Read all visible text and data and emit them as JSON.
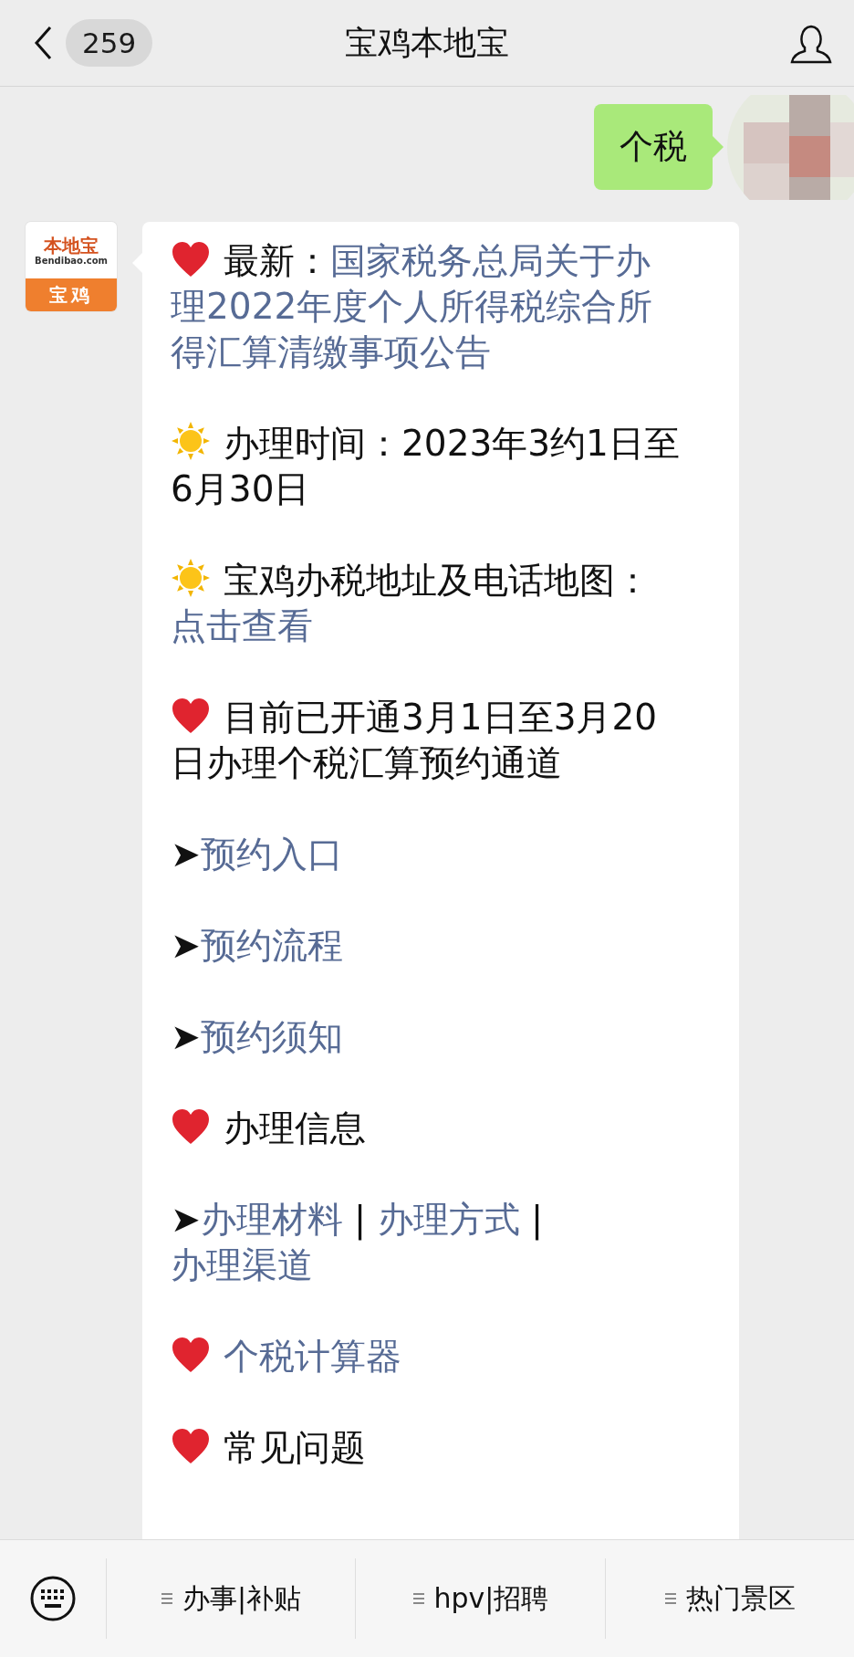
{
  "header": {
    "unread_count": "259",
    "title": "宝鸡本地宝"
  },
  "user_message": {
    "text": "个税"
  },
  "sender_logo": {
    "brand": "本地宝",
    "domain": "Bendibao.com",
    "city": "宝鸡"
  },
  "article": {
    "blocks": [
      {
        "kind": "heart",
        "segments": [
          {
            "text": "最新：",
            "link": false
          },
          {
            "text": "国家税务总局关于办",
            "link": true
          },
          {
            "text": "理2022年度个人所得税综合所",
            "link": true
          },
          {
            "text": "得汇算清缴事项公告",
            "link": true
          }
        ]
      },
      {
        "kind": "sun",
        "segments": [
          {
            "text": "办理时间：2023年3约1日至6月30日",
            "link": false
          }
        ]
      },
      {
        "kind": "sun",
        "segments": [
          {
            "text": "宝鸡办税地址及电话地图：",
            "link": false
          },
          {
            "text": "点击查看",
            "link": true
          }
        ]
      },
      {
        "kind": "heart",
        "segments": [
          {
            "text": "目前已开通3月1日至3月20日办理个税汇算预约通道",
            "link": false
          }
        ]
      },
      {
        "kind": "arrow",
        "marker": "➤",
        "segments": [
          {
            "text": "预约入口",
            "link": true
          }
        ]
      },
      {
        "kind": "arrow",
        "marker": "➤",
        "segments": [
          {
            "text": "预约流程",
            "link": true
          }
        ]
      },
      {
        "kind": "arrow",
        "marker": "➤",
        "segments": [
          {
            "text": "预约须知",
            "link": true
          }
        ]
      },
      {
        "kind": "heart",
        "segments": [
          {
            "text": "办理信息",
            "link": false
          }
        ]
      },
      {
        "kind": "arrow",
        "marker": "➤",
        "segments": [
          {
            "text": "办理材料",
            "link": true
          },
          {
            "text": " | ",
            "link": false
          },
          {
            "text": "办理方式",
            "link": true
          },
          {
            "text": " | ",
            "link": false
          },
          {
            "text": "办理渠道",
            "link": true
          }
        ]
      },
      {
        "kind": "heart",
        "segments": [
          {
            "text": "个税计算器",
            "link": true
          }
        ]
      },
      {
        "kind": "heart",
        "segments": [
          {
            "text": "常见问题",
            "link": false
          }
        ]
      }
    ]
  },
  "menu_bar": {
    "items": [
      {
        "label": "办事|补贴"
      },
      {
        "label": "hpv|招聘"
      },
      {
        "label": "热门景区"
      }
    ]
  }
}
